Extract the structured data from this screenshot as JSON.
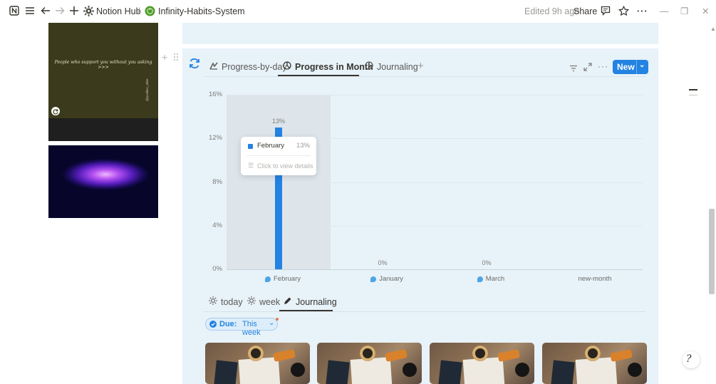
{
  "topbar": {
    "workspace": "Notion Hub",
    "separator": "/",
    "page_title": "Infinity-Habits-System",
    "edited": "Edited 9h ago",
    "share": "Share",
    "more": "···",
    "minimize": "—",
    "restore": "❐",
    "close": "✕"
  },
  "sidebar_images": {
    "quote": "People who support you without you asking >>>",
    "credit": "@positivo_alive"
  },
  "db_tabs": [
    {
      "label": "Progress-by-day",
      "icon": "graph-icon"
    },
    {
      "label": "Progress in Month",
      "icon": "chart-icon"
    },
    {
      "label": "Journaling",
      "icon": "chart-icon"
    }
  ],
  "new_button": {
    "label": "New"
  },
  "tooltip": {
    "name": "February",
    "value": "13%",
    "action": "Click to view details"
  },
  "chart_data": {
    "type": "bar",
    "categories": [
      "February",
      "January",
      "March",
      "new-month"
    ],
    "values": [
      13,
      0,
      0,
      null
    ],
    "data_labels": [
      "13%",
      "0%",
      "0%",
      ""
    ],
    "yticks": [
      "0%",
      "4%",
      "8%",
      "12%",
      "16%"
    ],
    "ylim": [
      0,
      16
    ],
    "grid": true,
    "highlighted_category": "February",
    "bar_color": "#2383e2"
  },
  "view_tabs": [
    {
      "label": "today",
      "icon": "sun-icon"
    },
    {
      "label": "week",
      "icon": "sun-icon"
    },
    {
      "label": "Journaling",
      "icon": "pencil-icon"
    }
  ],
  "filter": {
    "field": "Due:",
    "value": "This week"
  },
  "colors": {
    "accent": "#2383e2",
    "panel": "#e8f2f9"
  }
}
